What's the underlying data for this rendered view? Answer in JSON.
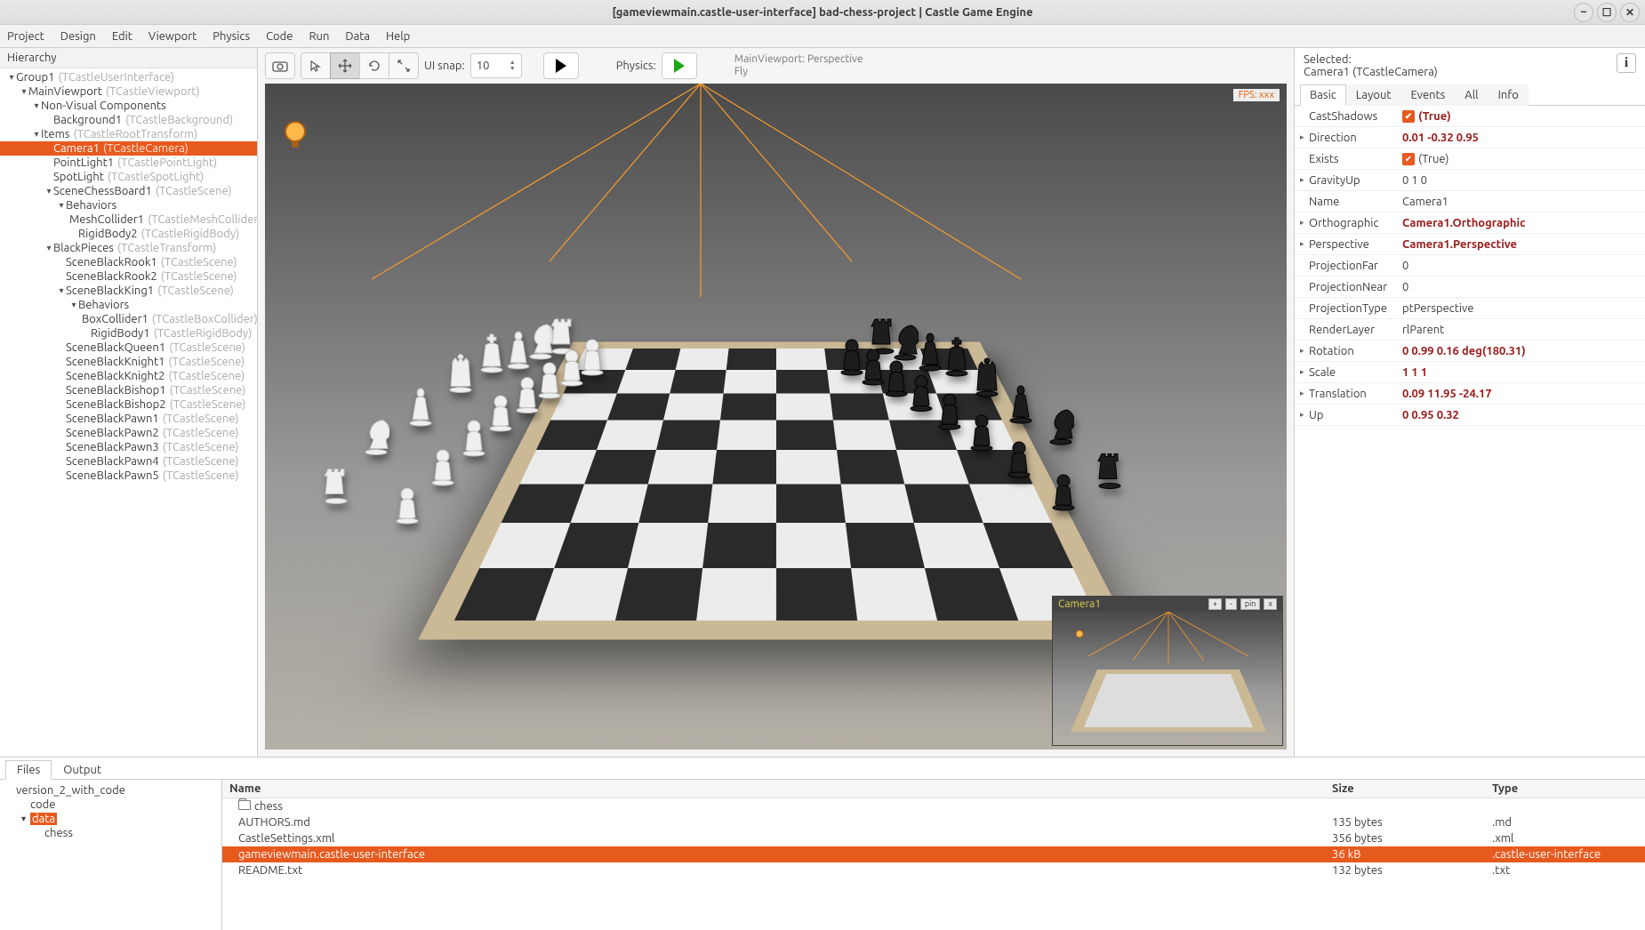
{
  "window": {
    "title": "[gameviewmain.castle-user-interface] bad-chess-project | Castle Game Engine"
  },
  "menu": [
    "Project",
    "Design",
    "Edit",
    "Viewport",
    "Physics",
    "Code",
    "Run",
    "Data",
    "Help"
  ],
  "hierarchy": {
    "title": "Hierarchy",
    "tree": [
      {
        "d": 0,
        "exp": "▾",
        "name": "Group1",
        "type": "(TCastleUserInterface)"
      },
      {
        "d": 1,
        "exp": "▾",
        "name": "MainViewport",
        "type": "(TCastleViewport)"
      },
      {
        "d": 2,
        "exp": "▾",
        "name": "Non-Visual Components",
        "type": ""
      },
      {
        "d": 3,
        "exp": "",
        "name": "Background1",
        "type": "(TCastleBackground)"
      },
      {
        "d": 2,
        "exp": "▾",
        "name": "Items",
        "type": "(TCastleRootTransform)"
      },
      {
        "d": 3,
        "exp": "",
        "name": "Camera1",
        "type": "(TCastleCamera)",
        "selected": true
      },
      {
        "d": 3,
        "exp": "",
        "name": "PointLight1",
        "type": "(TCastlePointLight)"
      },
      {
        "d": 3,
        "exp": "",
        "name": "SpotLight",
        "type": "(TCastleSpotLight)"
      },
      {
        "d": 3,
        "exp": "▾",
        "name": "SceneChessBoard1",
        "type": "(TCastleScene)"
      },
      {
        "d": 4,
        "exp": "▾",
        "name": "Behaviors",
        "type": ""
      },
      {
        "d": 5,
        "exp": "",
        "name": "MeshCollider1",
        "type": "(TCastleMeshCollider)"
      },
      {
        "d": 5,
        "exp": "",
        "name": "RigidBody2",
        "type": "(TCastleRigidBody)"
      },
      {
        "d": 3,
        "exp": "▾",
        "name": "BlackPieces",
        "type": "(TCastleTransform)"
      },
      {
        "d": 4,
        "exp": "",
        "name": "SceneBlackRook1",
        "type": "(TCastleScene)"
      },
      {
        "d": 4,
        "exp": "",
        "name": "SceneBlackRook2",
        "type": "(TCastleScene)"
      },
      {
        "d": 4,
        "exp": "▾",
        "name": "SceneBlackKing1",
        "type": "(TCastleScene)"
      },
      {
        "d": 5,
        "exp": "▾",
        "name": "Behaviors",
        "type": ""
      },
      {
        "d": 6,
        "exp": "",
        "name": "BoxCollider1",
        "type": "(TCastleBoxCollider)"
      },
      {
        "d": 6,
        "exp": "",
        "name": "RigidBody1",
        "type": "(TCastleRigidBody)"
      },
      {
        "d": 4,
        "exp": "",
        "name": "SceneBlackQueen1",
        "type": "(TCastleScene)"
      },
      {
        "d": 4,
        "exp": "",
        "name": "SceneBlackKnight1",
        "type": "(TCastleScene)"
      },
      {
        "d": 4,
        "exp": "",
        "name": "SceneBlackKnight2",
        "type": "(TCastleScene)"
      },
      {
        "d": 4,
        "exp": "",
        "name": "SceneBlackBishop1",
        "type": "(TCastleScene)"
      },
      {
        "d": 4,
        "exp": "",
        "name": "SceneBlackBishop2",
        "type": "(TCastleScene)"
      },
      {
        "d": 4,
        "exp": "",
        "name": "SceneBlackPawn1",
        "type": "(TCastleScene)"
      },
      {
        "d": 4,
        "exp": "",
        "name": "SceneBlackPawn2",
        "type": "(TCastleScene)"
      },
      {
        "d": 4,
        "exp": "",
        "name": "SceneBlackPawn3",
        "type": "(TCastleScene)"
      },
      {
        "d": 4,
        "exp": "",
        "name": "SceneBlackPawn4",
        "type": "(TCastleScene)"
      },
      {
        "d": 4,
        "exp": "",
        "name": "SceneBlackPawn5",
        "type": "(TCastleScene)"
      }
    ]
  },
  "toolbar": {
    "snap_label": "UI snap:",
    "snap_value": "10",
    "physics_label": "Physics:",
    "overlay_line1": "MainViewport: Perspective",
    "overlay_line2": "Fly"
  },
  "viewport": {
    "fps": "FPS: xxx",
    "camera_label": "Camera1",
    "overlay_buttons": [
      "+",
      "-",
      "pin",
      "x"
    ]
  },
  "inspector": {
    "selected_label": "Selected:",
    "selected_value": "Camera1 (TCastleCamera)",
    "tabs": [
      "Basic",
      "Layout",
      "Events",
      "All",
      "Info"
    ],
    "rows": [
      {
        "k": "CastShadows",
        "v": "(True)",
        "chk": true,
        "bold": true
      },
      {
        "k": "Direction",
        "v": "0.01 -0.32 0.95",
        "exp": true,
        "bold": true
      },
      {
        "k": "Exists",
        "v": "(True)",
        "chk": true
      },
      {
        "k": "GravityUp",
        "v": "0 1 0",
        "exp": true
      },
      {
        "k": "Name",
        "v": "Camera1"
      },
      {
        "k": "Orthographic",
        "v": "Camera1.Orthographic",
        "exp": true,
        "bold": true
      },
      {
        "k": "Perspective",
        "v": "Camera1.Perspective",
        "exp": true,
        "bold": true
      },
      {
        "k": "ProjectionFar",
        "v": "0"
      },
      {
        "k": "ProjectionNear",
        "v": "0"
      },
      {
        "k": "ProjectionType",
        "v": "ptPerspective"
      },
      {
        "k": "RenderLayer",
        "v": "rlParent"
      },
      {
        "k": "Rotation",
        "v": "0 0.99 0.16 deg(180.31)",
        "exp": true,
        "bold": true
      },
      {
        "k": "Scale",
        "v": "1 1 1",
        "exp": true,
        "bold": true
      },
      {
        "k": "Translation",
        "v": "0.09 11.95 -24.17",
        "exp": true,
        "bold": true
      },
      {
        "k": "Up",
        "v": "0 0.95 0.32",
        "exp": true,
        "bold": true
      }
    ]
  },
  "bottom": {
    "tabs": [
      "Files",
      "Output"
    ],
    "folders": [
      {
        "d": 0,
        "name": "version_2_with_code"
      },
      {
        "d": 1,
        "name": "code"
      },
      {
        "d": 1,
        "name": "data",
        "sel": true,
        "exp": "▾"
      },
      {
        "d": 2,
        "name": "chess"
      }
    ],
    "cols": {
      "name": "Name",
      "size": "Size",
      "type": "Type"
    },
    "files": [
      {
        "name": "chess",
        "size": "",
        "type": "",
        "folder": true
      },
      {
        "name": "AUTHORS.md",
        "size": "135 bytes",
        "type": ".md"
      },
      {
        "name": "CastleSettings.xml",
        "size": "356 bytes",
        "type": ".xml"
      },
      {
        "name": "gameviewmain.castle-user-interface",
        "size": "36 kB",
        "type": ".castle-user-interface",
        "sel": true
      },
      {
        "name": "README.txt",
        "size": "132 bytes",
        "type": ".txt"
      }
    ]
  }
}
